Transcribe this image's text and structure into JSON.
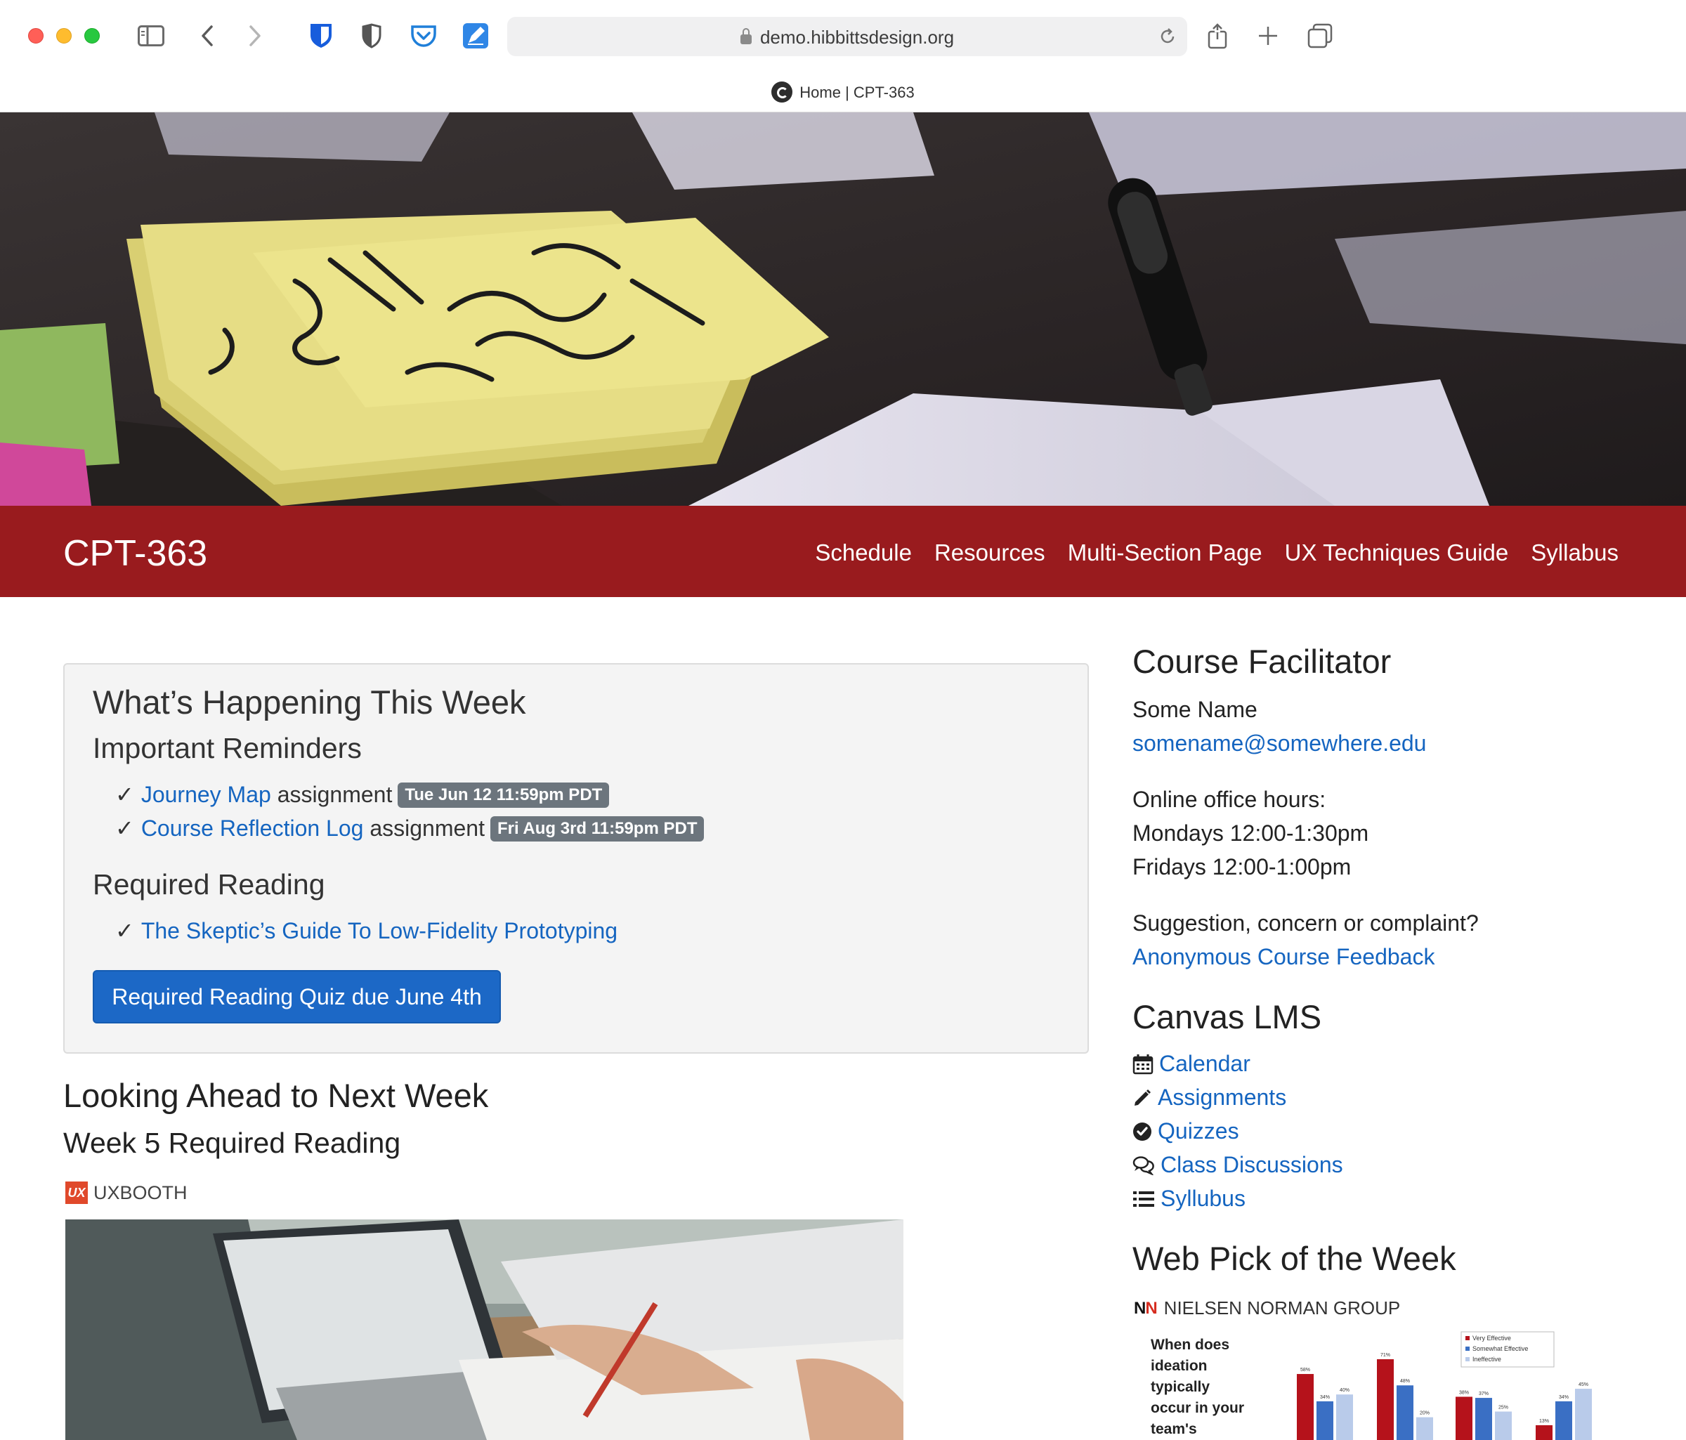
{
  "browser": {
    "url": "demo.hibbittsdesign.org",
    "tab_title": "Home | CPT-363"
  },
  "navbar": {
    "brand": "CPT-363",
    "links": [
      "Schedule",
      "Resources",
      "Multi-Section Page",
      "UX Techniques Guide",
      "Syllabus"
    ]
  },
  "this_week": {
    "heading": "What’s Happening This Week",
    "reminders_heading": "Important Reminders",
    "reminders": [
      {
        "link": "Journey Map",
        "suffix": " assignment",
        "due": "Tue Jun 12 11:59pm PDT"
      },
      {
        "link": "Course Reflection Log",
        "suffix": " assignment",
        "due": "Fri Aug 3rd 11:59pm PDT"
      }
    ],
    "reading_heading": "Required Reading",
    "reading_link": "The Skeptic’s Guide To Low-Fidelity Prototyping",
    "quiz_button": "Required Reading Quiz due June 4th"
  },
  "next_week": {
    "heading": "Looking Ahead to Next Week",
    "subheading": "Week 5 Required Reading",
    "source_logo": "UX",
    "source": "UXBOOTH"
  },
  "sidebar": {
    "facilitator_heading": "Course Facilitator",
    "facilitator_name": "Some Name",
    "facilitator_email": "somename@somewhere.edu",
    "office_hours_label": "Online office hours:",
    "office_hours_1": "Mondays 12:00-1:30pm",
    "office_hours_2": "Fridays 12:00-1:00pm",
    "feedback_prompt": "Suggestion, concern or complaint?",
    "feedback_link": "Anonymous Course Feedback",
    "lms_heading": "Canvas LMS",
    "lms_links": [
      {
        "label": "Calendar",
        "icon": "calendar-icon"
      },
      {
        "label": "Assignments",
        "icon": "pencil-icon"
      },
      {
        "label": "Quizzes",
        "icon": "check-circle-icon"
      },
      {
        "label": "Class Discussions",
        "icon": "comments-icon"
      },
      {
        "label": "Syllubus",
        "icon": "list-icon"
      }
    ],
    "web_pick_heading": "Web Pick of the Week",
    "web_pick_logo": "NN",
    "web_pick_source": "NIELSEN NORMAN GROUP",
    "web_pick_caption": [
      "When does",
      "ideation",
      "typically",
      "occur in your",
      "team's"
    ],
    "web_pick_legend": [
      "Very Effective",
      "Somewhat Effective",
      "Ineffective"
    ],
    "web_pick_labels": [
      "58%",
      "34%",
      "40%",
      "71%",
      "48%",
      "20%",
      "38%",
      "37%",
      "25%",
      "13%",
      "34%",
      "45%"
    ],
    "colors": {
      "very": "#b5121b",
      "somewhat": "#3a6fc4",
      "ineffective": "#b9cbea"
    }
  }
}
